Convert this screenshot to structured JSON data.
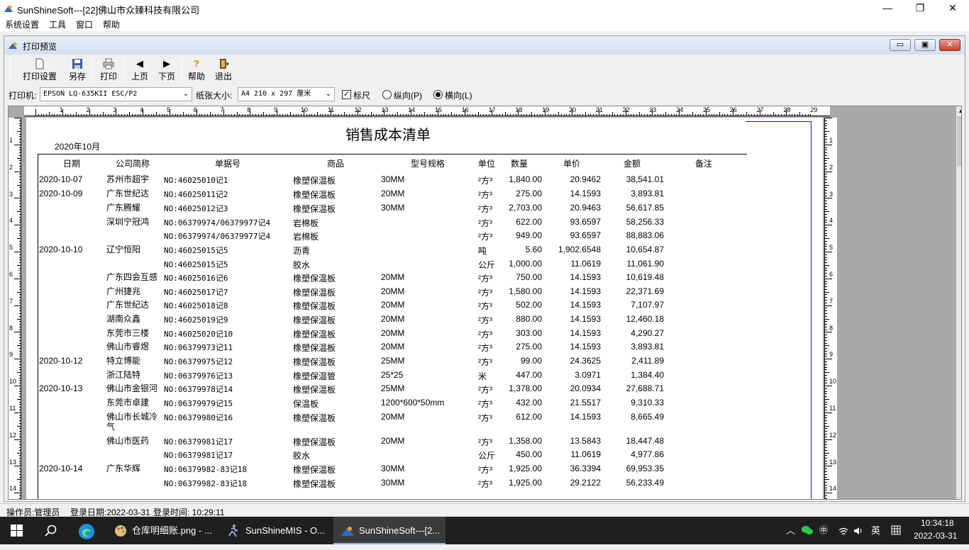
{
  "app": {
    "title": "SunShineSoft---[22]佛山市众臻科技有限公司",
    "min": "—",
    "max": "❐",
    "close": "✕"
  },
  "menu": [
    "系统设置",
    "工具",
    "窗口",
    "帮助"
  ],
  "child": {
    "title": "打印预览",
    "min": "▭",
    "max": "▣",
    "close": "✕"
  },
  "toolbar": {
    "print_setup": "打印设置",
    "save_as": "另存",
    "print": "打印",
    "prev": "上页",
    "next": "下页",
    "help": "帮助",
    "exit": "退出",
    "prev_icon": "◀",
    "next_icon": "▶",
    "help_icon": "?"
  },
  "options": {
    "printer_label": "打印机:",
    "printer": "EPSON LQ-635KII ESC/P2",
    "paper_label": "纸张大小:",
    "paper": "A4 210 x 297 厘米",
    "ruler_label": "标尺",
    "ruler_checked": "✓",
    "portrait_label": "纵向(P)",
    "landscape_label": "横向(L)"
  },
  "ruler_h": [
    "1",
    "2",
    "3",
    "4",
    "5",
    "6",
    "7",
    "8",
    "9",
    "10",
    "11",
    "12",
    "13",
    "14",
    "15",
    "16",
    "17",
    "18",
    "19",
    "20",
    "21",
    "22",
    "23",
    "24",
    "25",
    "26",
    "27",
    "28",
    "29"
  ],
  "ruler_v": [
    "1",
    "2",
    "3",
    "4",
    "5",
    "6",
    "7",
    "8",
    "9",
    "10",
    "11",
    "12",
    "13",
    "14"
  ],
  "report": {
    "title": "销售成本清单",
    "month": "2020年10月",
    "headers": [
      "日期",
      "公司简称",
      "单据号",
      "商品",
      "型号规格",
      "单位",
      "数量",
      "单价",
      "金额",
      "备注"
    ],
    "rows": [
      {
        "date": "2020-10-07",
        "company": "苏州市超宇",
        "no": "NO:46025010记1",
        "item": "橡塑保温板",
        "spec": "30MM",
        "unit": "²方³",
        "qty": "1,840.00",
        "price": "20.9462",
        "amount": "38,541.01"
      },
      {
        "date": "2020-10-09",
        "company": "广东世纪达",
        "no": "NO:46025011记2",
        "item": "橡塑保温板",
        "spec": "20MM",
        "unit": "²方³",
        "qty": "275.00",
        "price": "14.1593",
        "amount": "3,893.81"
      },
      {
        "date": "",
        "company": "广东腾耀",
        "no": "NO:46025012记3",
        "item": "橡塑保温板",
        "spec": "30MM",
        "unit": "²方³",
        "qty": "2,703.00",
        "price": "20.9463",
        "amount": "56,617.85"
      },
      {
        "date": "",
        "company": "深圳宁冠鸿",
        "no": "NO:06379974/06379977记4",
        "item": "岩棉板",
        "spec": "",
        "unit": "²方³",
        "qty": "622.00",
        "price": "93.6597",
        "amount": "58,256.33"
      },
      {
        "date": "",
        "company": "",
        "no": "NO:06379974/06379977记4",
        "item": "岩棉板",
        "spec": "",
        "unit": "²方³",
        "qty": "949.00",
        "price": "93.6597",
        "amount": "88,883.06"
      },
      {
        "date": "2020-10-10",
        "company": "辽宁恒阳",
        "no": "NO:46025015记5",
        "item": "沥青",
        "spec": "",
        "unit": "吨",
        "qty": "5.60",
        "price": "1,902.6548",
        "amount": "10,654.87"
      },
      {
        "date": "",
        "company": "",
        "no": "NO:46025015记5",
        "item": "胶水",
        "spec": "",
        "unit": "公斤",
        "qty": "1,000.00",
        "price": "11.0619",
        "amount": "11,061.90"
      },
      {
        "date": "",
        "company": "广东四会互感",
        "no": "NO:46025016记6",
        "item": "橡塑保温板",
        "spec": "20MM",
        "unit": "²方³",
        "qty": "750.00",
        "price": "14.1593",
        "amount": "10,619.48"
      },
      {
        "date": "",
        "company": "广州捷兆",
        "no": "NO:46025017记7",
        "item": "橡塑保温板",
        "spec": "20MM",
        "unit": "²方³",
        "qty": "1,580.00",
        "price": "14.1593",
        "amount": "22,371.69"
      },
      {
        "date": "",
        "company": "广东世纪达",
        "no": "NO:46025018记8",
        "item": "橡塑保温板",
        "spec": "20MM",
        "unit": "²方³",
        "qty": "502.00",
        "price": "14.1593",
        "amount": "7,107.97"
      },
      {
        "date": "",
        "company": "湖南众鑫",
        "no": "NO:46025019记9",
        "item": "橡塑保温板",
        "spec": "20MM",
        "unit": "²方³",
        "qty": "880.00",
        "price": "14.1593",
        "amount": "12,460.18"
      },
      {
        "date": "",
        "company": "东莞市三楼",
        "no": "NO:46025020记10",
        "item": "橡塑保温板",
        "spec": "20MM",
        "unit": "²方³",
        "qty": "303.00",
        "price": "14.1593",
        "amount": "4,290.27"
      },
      {
        "date": "",
        "company": "佛山市睿煜",
        "no": "NO:06379973记11",
        "item": "橡塑保温板",
        "spec": "20MM",
        "unit": "²方³",
        "qty": "275.00",
        "price": "14.1593",
        "amount": "3,893.81"
      },
      {
        "date": "2020-10-12",
        "company": "特立博能",
        "no": "NO:06379975记12",
        "item": "橡塑保温板",
        "spec": "25MM",
        "unit": "²方³",
        "qty": "99.00",
        "price": "24.3625",
        "amount": "2,411.89"
      },
      {
        "date": "",
        "company": "浙江陆特",
        "no": "NO:06379976记13",
        "item": "橡塑保温管",
        "spec": "25*25",
        "unit": "米",
        "qty": "447.00",
        "price": "3.0971",
        "amount": "1,384.40"
      },
      {
        "date": "2020-10-13",
        "company": "佛山市金银河",
        "no": "NO:06379978记14",
        "item": "橡塑保温板",
        "spec": "25MM",
        "unit": "²方³",
        "qty": "1,378.00",
        "price": "20.0934",
        "amount": "27,688.71"
      },
      {
        "date": "",
        "company": "东莞市卓建",
        "no": "NO:06379979记15",
        "item": "保温板",
        "spec": "1200*600*50mm",
        "unit": "²方³",
        "qty": "432.00",
        "price": "21.5517",
        "amount": "9,310.33"
      },
      {
        "date": "",
        "company": "佛山市长城冷气",
        "no": "NO:06379980记16",
        "item": "橡塑保温板",
        "spec": "20MM",
        "unit": "²方³",
        "qty": "612.00",
        "price": "14.1593",
        "amount": "8,665.49"
      },
      {
        "date": "",
        "company": "佛山市医药",
        "no": "NO:06379981记17",
        "item": "橡塑保温板",
        "spec": "20MM",
        "unit": "²方³",
        "qty": "1,358.00",
        "price": "13.5843",
        "amount": "18,447.48"
      },
      {
        "date": "",
        "company": "",
        "no": "NO:06379981记17",
        "item": "胶水",
        "spec": "",
        "unit": "公斤",
        "qty": "450.00",
        "price": "11.0619",
        "amount": "4,977.86"
      },
      {
        "date": "2020-10-14",
        "company": "广东华辉",
        "no": "NO:06379982-83记18",
        "item": "橡塑保温板",
        "spec": "30MM",
        "unit": "²方³",
        "qty": "1,925.00",
        "price": "36.3394",
        "amount": "69,953.35"
      },
      {
        "date": "",
        "company": "",
        "no": "NO:06379982-83记18",
        "item": "橡塑保温板",
        "spec": "30MM",
        "unit": "²方³",
        "qty": "1,925.00",
        "price": "29.2122",
        "amount": "56,233.49"
      }
    ]
  },
  "status": {
    "operator": "操作员:管理员",
    "login_date": "登录日期:2022-03-31",
    "login_time": "登录时间: 10:29:11"
  },
  "taskbar": {
    "items": [
      "仓库明细账.png - ...",
      "SunShineMIS - O...",
      "SunShineSoft---[2..."
    ],
    "tray_ime": "英",
    "clock_time": "10:34:18",
    "clock_date": "2022-03-31"
  }
}
